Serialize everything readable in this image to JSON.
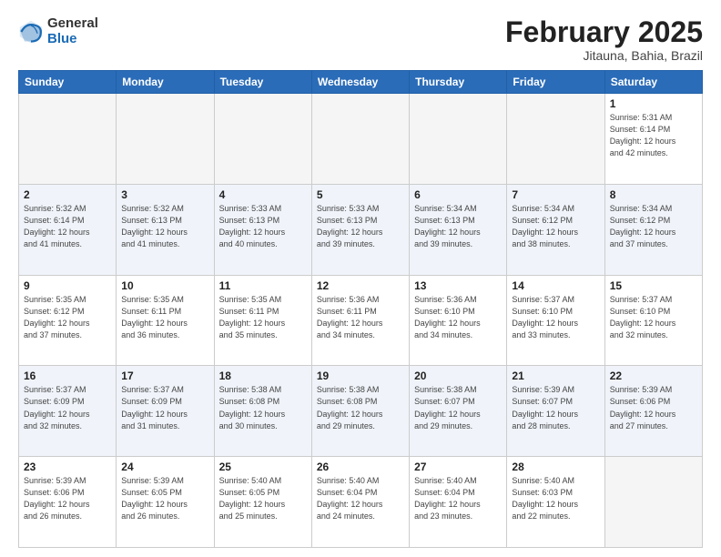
{
  "header": {
    "logo_general": "General",
    "logo_blue": "Blue",
    "month_title": "February 2025",
    "location": "Jitauna, Bahia, Brazil"
  },
  "weekdays": [
    "Sunday",
    "Monday",
    "Tuesday",
    "Wednesday",
    "Thursday",
    "Friday",
    "Saturday"
  ],
  "weeks": [
    [
      {
        "day": "",
        "info": ""
      },
      {
        "day": "",
        "info": ""
      },
      {
        "day": "",
        "info": ""
      },
      {
        "day": "",
        "info": ""
      },
      {
        "day": "",
        "info": ""
      },
      {
        "day": "",
        "info": ""
      },
      {
        "day": "1",
        "info": "Sunrise: 5:31 AM\nSunset: 6:14 PM\nDaylight: 12 hours\nand 42 minutes."
      }
    ],
    [
      {
        "day": "2",
        "info": "Sunrise: 5:32 AM\nSunset: 6:14 PM\nDaylight: 12 hours\nand 41 minutes."
      },
      {
        "day": "3",
        "info": "Sunrise: 5:32 AM\nSunset: 6:13 PM\nDaylight: 12 hours\nand 41 minutes."
      },
      {
        "day": "4",
        "info": "Sunrise: 5:33 AM\nSunset: 6:13 PM\nDaylight: 12 hours\nand 40 minutes."
      },
      {
        "day": "5",
        "info": "Sunrise: 5:33 AM\nSunset: 6:13 PM\nDaylight: 12 hours\nand 39 minutes."
      },
      {
        "day": "6",
        "info": "Sunrise: 5:34 AM\nSunset: 6:13 PM\nDaylight: 12 hours\nand 39 minutes."
      },
      {
        "day": "7",
        "info": "Sunrise: 5:34 AM\nSunset: 6:12 PM\nDaylight: 12 hours\nand 38 minutes."
      },
      {
        "day": "8",
        "info": "Sunrise: 5:34 AM\nSunset: 6:12 PM\nDaylight: 12 hours\nand 37 minutes."
      }
    ],
    [
      {
        "day": "9",
        "info": "Sunrise: 5:35 AM\nSunset: 6:12 PM\nDaylight: 12 hours\nand 37 minutes."
      },
      {
        "day": "10",
        "info": "Sunrise: 5:35 AM\nSunset: 6:11 PM\nDaylight: 12 hours\nand 36 minutes."
      },
      {
        "day": "11",
        "info": "Sunrise: 5:35 AM\nSunset: 6:11 PM\nDaylight: 12 hours\nand 35 minutes."
      },
      {
        "day": "12",
        "info": "Sunrise: 5:36 AM\nSunset: 6:11 PM\nDaylight: 12 hours\nand 34 minutes."
      },
      {
        "day": "13",
        "info": "Sunrise: 5:36 AM\nSunset: 6:10 PM\nDaylight: 12 hours\nand 34 minutes."
      },
      {
        "day": "14",
        "info": "Sunrise: 5:37 AM\nSunset: 6:10 PM\nDaylight: 12 hours\nand 33 minutes."
      },
      {
        "day": "15",
        "info": "Sunrise: 5:37 AM\nSunset: 6:10 PM\nDaylight: 12 hours\nand 32 minutes."
      }
    ],
    [
      {
        "day": "16",
        "info": "Sunrise: 5:37 AM\nSunset: 6:09 PM\nDaylight: 12 hours\nand 32 minutes."
      },
      {
        "day": "17",
        "info": "Sunrise: 5:37 AM\nSunset: 6:09 PM\nDaylight: 12 hours\nand 31 minutes."
      },
      {
        "day": "18",
        "info": "Sunrise: 5:38 AM\nSunset: 6:08 PM\nDaylight: 12 hours\nand 30 minutes."
      },
      {
        "day": "19",
        "info": "Sunrise: 5:38 AM\nSunset: 6:08 PM\nDaylight: 12 hours\nand 29 minutes."
      },
      {
        "day": "20",
        "info": "Sunrise: 5:38 AM\nSunset: 6:07 PM\nDaylight: 12 hours\nand 29 minutes."
      },
      {
        "day": "21",
        "info": "Sunrise: 5:39 AM\nSunset: 6:07 PM\nDaylight: 12 hours\nand 28 minutes."
      },
      {
        "day": "22",
        "info": "Sunrise: 5:39 AM\nSunset: 6:06 PM\nDaylight: 12 hours\nand 27 minutes."
      }
    ],
    [
      {
        "day": "23",
        "info": "Sunrise: 5:39 AM\nSunset: 6:06 PM\nDaylight: 12 hours\nand 26 minutes."
      },
      {
        "day": "24",
        "info": "Sunrise: 5:39 AM\nSunset: 6:05 PM\nDaylight: 12 hours\nand 26 minutes."
      },
      {
        "day": "25",
        "info": "Sunrise: 5:40 AM\nSunset: 6:05 PM\nDaylight: 12 hours\nand 25 minutes."
      },
      {
        "day": "26",
        "info": "Sunrise: 5:40 AM\nSunset: 6:04 PM\nDaylight: 12 hours\nand 24 minutes."
      },
      {
        "day": "27",
        "info": "Sunrise: 5:40 AM\nSunset: 6:04 PM\nDaylight: 12 hours\nand 23 minutes."
      },
      {
        "day": "28",
        "info": "Sunrise: 5:40 AM\nSunset: 6:03 PM\nDaylight: 12 hours\nand 22 minutes."
      },
      {
        "day": "",
        "info": ""
      }
    ]
  ]
}
